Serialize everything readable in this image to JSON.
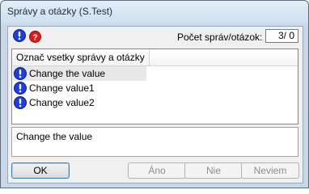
{
  "window": {
    "title": "Správy a otázky (S.Test)"
  },
  "header": {
    "count_label": "Počet správ/otázok:",
    "count_value": "3/ 0"
  },
  "list": {
    "column_header": "Označ vsetky správy a otázky",
    "items": [
      {
        "label": "Change the value",
        "icon": "info-exclamation-icon",
        "selected": true
      },
      {
        "label": "Change value1",
        "icon": "info-exclamation-icon",
        "selected": false
      },
      {
        "label": "Change value2",
        "icon": "info-exclamation-icon",
        "selected": false
      }
    ]
  },
  "detail": {
    "text": "Change the value"
  },
  "buttons": {
    "ok": "OK",
    "yes": "Áno",
    "no": "Nie",
    "dont_know": "Neviem"
  },
  "colors": {
    "info_blue": "#1d3fd6",
    "question_red": "#d81e1e"
  }
}
